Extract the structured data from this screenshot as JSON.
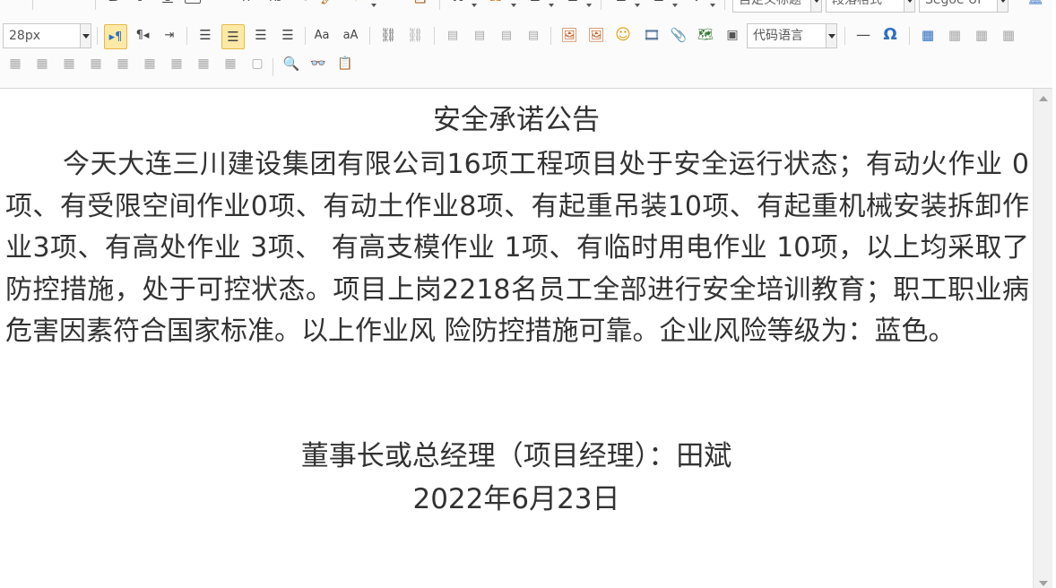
{
  "toolbar": {
    "font_size_value": "28px",
    "custom_heading": "自定义标题",
    "paragraph_format": "段落格式",
    "font_family": "Segoe UI",
    "code_language": "代码语言",
    "icons": {
      "html": "HTML",
      "bold": "B",
      "italic": "I",
      "underline": "U",
      "strikethrough": "ABC",
      "superscript": "X²",
      "subscript": "X₂",
      "font_color": "A",
      "quote": "❝",
      "omega": "Ω",
      "dash": "—"
    }
  },
  "document": {
    "title": "安全承诺公告",
    "body": "今天大连三川建设集团有限公司16项工程项目处于安全运行状态；有动火作业 0项、有受限空间作业0项、有动土作业8项、有起重吊装10项、有起重机械安装拆卸作业3项、有高处作业 3项、 有高支模作业 1项、有临时用电作业 10项，以上均采取了防控措施，处于可控状态。项目上岗2218名员工全部进行安全培训教育；职工职业病危害因素符合国家标准。以上作业风 险防控措施可靠。企业风险等级为：蓝色。",
    "signer": "董事长或总经理（项目经理）：田斌",
    "date": "2022年6月23日"
  },
  "colors": {
    "active_button_bg": "#fde9a6",
    "text": "#333333",
    "accent_blue": "#2f6ec0"
  }
}
